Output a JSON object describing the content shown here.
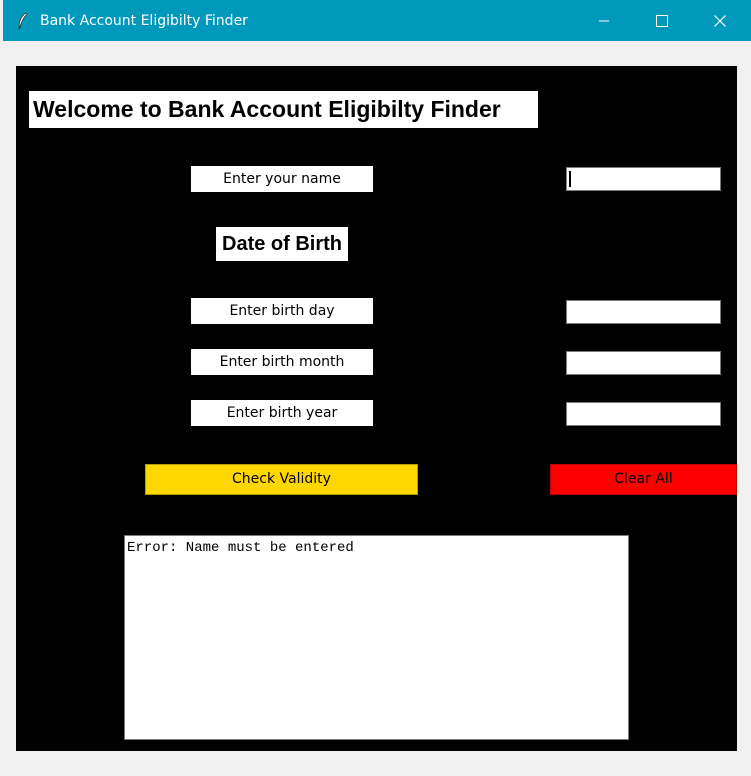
{
  "window": {
    "title": "Bank Account Eligibilty Finder",
    "titlebar_color": "#0099bc"
  },
  "form": {
    "heading": "Welcome to Bank Account Eligibilty Finder",
    "name_label": "Enter your name",
    "name_value": "",
    "dob_heading": "Date of Birth",
    "day_label": "Enter birth day",
    "day_value": "",
    "month_label": "Enter birth month",
    "month_value": "",
    "year_label": "Enter birth year",
    "year_value": ""
  },
  "buttons": {
    "check_label": "Check Validity",
    "check_color": "#ffd700",
    "clear_label": "Clear All",
    "clear_color": "#ff0000"
  },
  "output": {
    "text": "Error: Name must be entered"
  }
}
